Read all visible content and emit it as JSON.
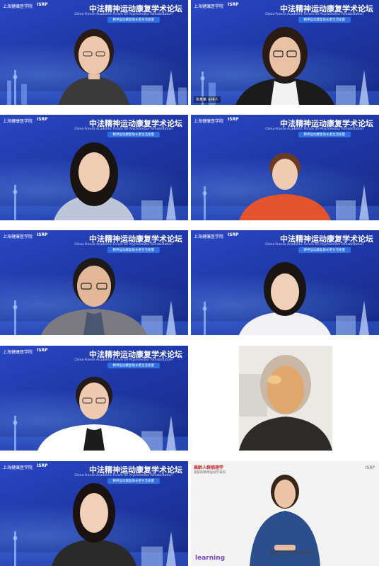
{
  "conference": {
    "title": "中法精神运动康复学术论坛",
    "subtitle": "China-France Academic Forum on Psychomotor Rehabilitation",
    "banner": "精神运动康复助长者生活质量",
    "logo_text": "上海健康医学院",
    "partner_logo": "ISRP"
  },
  "tiles": [
    {
      "name": "participant-1",
      "top_color": "#1b1b1b",
      "shirt": "#3a3a3a",
      "hair": "#2a1b14"
    },
    {
      "name": "participant-2",
      "top_color": "#1b1b1b",
      "shirt": "#2b2b2b",
      "hair": "#2a1b14",
      "name_tag": "张某某 主持人"
    },
    {
      "name": "participant-3",
      "top_color": "#1b1b1b",
      "shirt": "#bcc6d8",
      "hair": "#1a1410"
    },
    {
      "name": "participant-4",
      "top_color": "#1b1b1b",
      "shirt": "#e5532e",
      "hair": "#6a3a22"
    },
    {
      "name": "participant-5",
      "top_color": "#1b1b1b",
      "shirt": "#7a7a80",
      "hair": "#1e1a18"
    },
    {
      "name": "participant-6",
      "top_color": "#1b1b1b",
      "shirt": "#f1f1f4",
      "hair": "#1a1412"
    },
    {
      "name": "participant-7",
      "top_color": "#1b1b1b",
      "shirt": "#ffffff",
      "hair": "#221b18"
    },
    {
      "name": "participant-9",
      "top_color": "#1b1b1b",
      "shirt": "#2a2a2a",
      "hair": "#1a1210"
    }
  ],
  "webcam": {
    "name": "participant-8"
  },
  "lecture": {
    "title": "高龄人群病理学",
    "subtitle": "高龄的精神运动学表现",
    "isrp": "ISRP",
    "logo": "learning",
    "caption": "新的学习精神的关键发展"
  }
}
